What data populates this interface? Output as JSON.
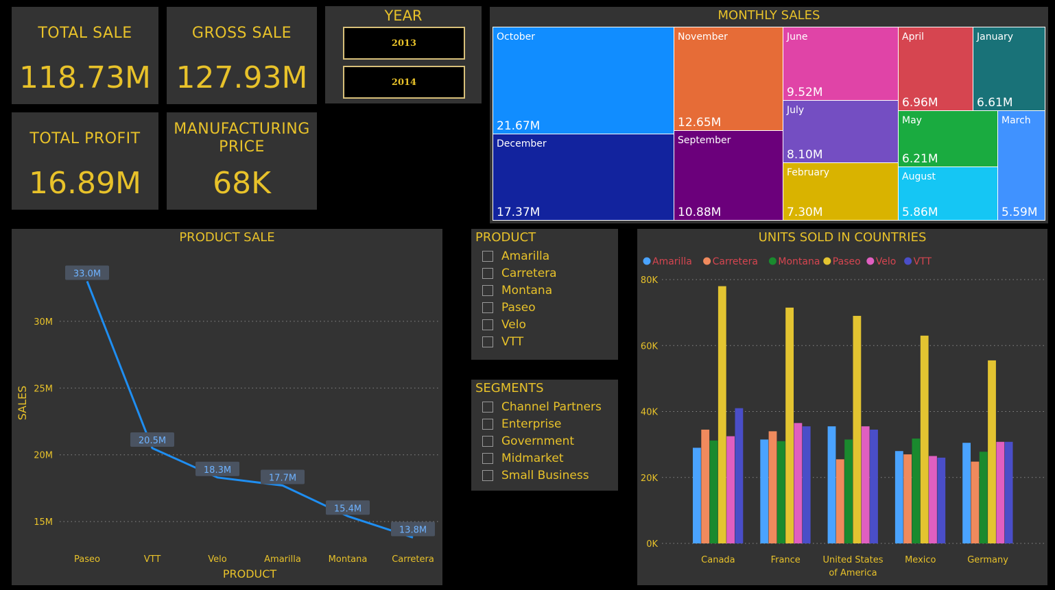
{
  "kpis": {
    "total_sale": {
      "label": "TOTAL SALE",
      "value": "118.73M"
    },
    "gross_sale": {
      "label": "GROSS SALE",
      "value": "127.93M"
    },
    "total_profit": {
      "label": "TOTAL PROFIT",
      "value": "16.89M"
    },
    "manufacturing_price": {
      "label_line1": "MANUFACTURING",
      "label_line2": "PRICE",
      "value": "68K"
    }
  },
  "year_slicer": {
    "title": "YEAR",
    "options": [
      "2013",
      "2014"
    ]
  },
  "product_slicer": {
    "title": "PRODUCT",
    "items": [
      "Amarilla",
      "Carretera",
      "Montana",
      "Paseo",
      "Velo",
      "VTT"
    ]
  },
  "segments_slicer": {
    "title": "SEGMENTS",
    "items": [
      "Channel Partners",
      "Enterprise",
      "Government",
      "Midmarket",
      "Small Business"
    ]
  },
  "colors": {
    "accent": "#e8c22a",
    "panel": "#333333",
    "background": "#000000",
    "line": "#1f8ef1"
  },
  "chart_data": [
    {
      "type": "treemap",
      "title": "MONTHLY SALES",
      "tiles": [
        {
          "label": "October",
          "value_label": "21.67M",
          "value": 21.67,
          "color": "#118dff"
        },
        {
          "label": "December",
          "value_label": "17.37M",
          "value": 17.37,
          "color": "#12239e"
        },
        {
          "label": "November",
          "value_label": "12.65M",
          "value": 12.65,
          "color": "#e66c37"
        },
        {
          "label": "September",
          "value_label": "10.88M",
          "value": 10.88,
          "color": "#6b007b"
        },
        {
          "label": "June",
          "value_label": "9.52M",
          "value": 9.52,
          "color": "#e044a7"
        },
        {
          "label": "July",
          "value_label": "8.10M",
          "value": 8.1,
          "color": "#744ec2"
        },
        {
          "label": "February",
          "value_label": "7.30M",
          "value": 7.3,
          "color": "#d9b300"
        },
        {
          "label": "April",
          "value_label": "6.96M",
          "value": 6.96,
          "color": "#d64550"
        },
        {
          "label": "January",
          "value_label": "6.61M",
          "value": 6.61,
          "color": "#197278"
        },
        {
          "label": "May",
          "value_label": "6.21M",
          "value": 6.21,
          "color": "#1aab40"
        },
        {
          "label": "August",
          "value_label": "5.86M",
          "value": 5.86,
          "color": "#15c6f4"
        },
        {
          "label": "March",
          "value_label": "5.59M",
          "value": 5.59,
          "color": "#4092ff"
        }
      ]
    },
    {
      "type": "line",
      "title": "PRODUCT SALE",
      "xlabel": "PRODUCT",
      "ylabel": "SALES",
      "categories": [
        "Paseo",
        "VTT",
        "Velo",
        "Amarilla",
        "Montana",
        "Carretera"
      ],
      "values": [
        33.0,
        20.5,
        18.3,
        17.7,
        15.4,
        13.8
      ],
      "value_labels": [
        "33.0M",
        "20.5M",
        "18.3M",
        "17.7M",
        "15.4M",
        "13.8M"
      ],
      "yticks": [
        15,
        20,
        25,
        30
      ],
      "ytick_labels": [
        "15M",
        "20M",
        "25M",
        "30M"
      ],
      "ylim": [
        11,
        34
      ],
      "grid": true
    },
    {
      "type": "bar",
      "title": "UNITS SOLD IN COUNTRIES",
      "legend_position": "top-left",
      "categories": [
        "Canada",
        "France",
        "United States of America",
        "Mexico",
        "Germany"
      ],
      "yticks": [
        0,
        20000,
        40000,
        60000,
        80000
      ],
      "ytick_labels": [
        "0K",
        "20K",
        "40K",
        "60K",
        "80K"
      ],
      "ylim": [
        0,
        80000
      ],
      "grid": true,
      "series": [
        {
          "name": "Amarilla",
          "color": "#4aa3ff",
          "values": [
            29000,
            31500,
            35500,
            28000,
            30500
          ]
        },
        {
          "name": "Carretera",
          "color": "#f08a5d",
          "values": [
            34500,
            34000,
            25500,
            27000,
            24800
          ]
        },
        {
          "name": "Montana",
          "color": "#1a8a2e",
          "values": [
            31200,
            31000,
            31500,
            31800,
            27800
          ]
        },
        {
          "name": "Paseo",
          "color": "#e3c431",
          "values": [
            78000,
            71500,
            69000,
            63000,
            55500
          ]
        },
        {
          "name": "Velo",
          "color": "#e05fc0",
          "values": [
            32500,
            36500,
            35500,
            26500,
            30800
          ]
        },
        {
          "name": "VTT",
          "color": "#4a4ec8",
          "values": [
            41000,
            35500,
            34500,
            26000,
            30800
          ]
        }
      ]
    }
  ]
}
